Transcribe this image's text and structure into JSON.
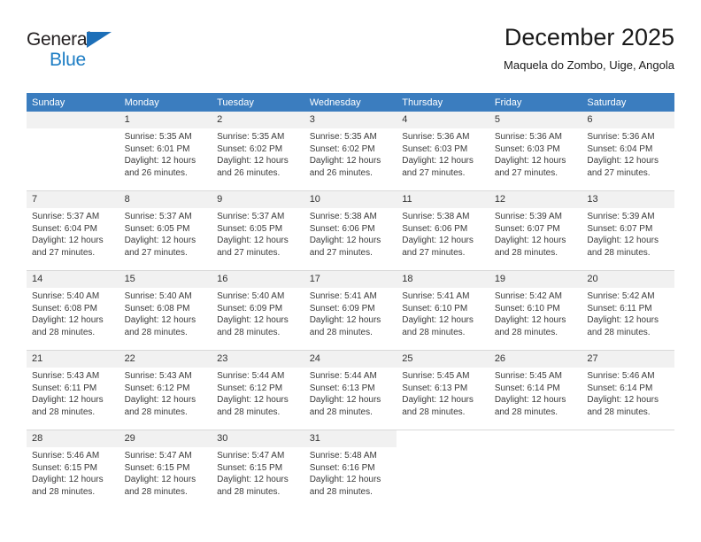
{
  "brand": {
    "name_part1": "General",
    "name_part2": "Blue",
    "triangle_icon": "triangle-icon",
    "colors": {
      "blue": "#1d7dc4",
      "dark": "#231f20",
      "header_blue": "#3b7dbf"
    }
  },
  "header": {
    "title": "December 2025",
    "subtitle": "Maquela do Zombo, Uige, Angola"
  },
  "weekday_headers": [
    "Sunday",
    "Monday",
    "Tuesday",
    "Wednesday",
    "Thursday",
    "Friday",
    "Saturday"
  ],
  "weeks": [
    [
      {
        "day": "",
        "sunrise": "",
        "sunset": "",
        "daylight_line1": "",
        "daylight_line2": "",
        "empty": true
      },
      {
        "day": "1",
        "sunrise": "Sunrise: 5:35 AM",
        "sunset": "Sunset: 6:01 PM",
        "daylight_line1": "Daylight: 12 hours",
        "daylight_line2": "and 26 minutes."
      },
      {
        "day": "2",
        "sunrise": "Sunrise: 5:35 AM",
        "sunset": "Sunset: 6:02 PM",
        "daylight_line1": "Daylight: 12 hours",
        "daylight_line2": "and 26 minutes."
      },
      {
        "day": "3",
        "sunrise": "Sunrise: 5:35 AM",
        "sunset": "Sunset: 6:02 PM",
        "daylight_line1": "Daylight: 12 hours",
        "daylight_line2": "and 26 minutes."
      },
      {
        "day": "4",
        "sunrise": "Sunrise: 5:36 AM",
        "sunset": "Sunset: 6:03 PM",
        "daylight_line1": "Daylight: 12 hours",
        "daylight_line2": "and 27 minutes."
      },
      {
        "day": "5",
        "sunrise": "Sunrise: 5:36 AM",
        "sunset": "Sunset: 6:03 PM",
        "daylight_line1": "Daylight: 12 hours",
        "daylight_line2": "and 27 minutes."
      },
      {
        "day": "6",
        "sunrise": "Sunrise: 5:36 AM",
        "sunset": "Sunset: 6:04 PM",
        "daylight_line1": "Daylight: 12 hours",
        "daylight_line2": "and 27 minutes."
      }
    ],
    [
      {
        "day": "7",
        "sunrise": "Sunrise: 5:37 AM",
        "sunset": "Sunset: 6:04 PM",
        "daylight_line1": "Daylight: 12 hours",
        "daylight_line2": "and 27 minutes."
      },
      {
        "day": "8",
        "sunrise": "Sunrise: 5:37 AM",
        "sunset": "Sunset: 6:05 PM",
        "daylight_line1": "Daylight: 12 hours",
        "daylight_line2": "and 27 minutes."
      },
      {
        "day": "9",
        "sunrise": "Sunrise: 5:37 AM",
        "sunset": "Sunset: 6:05 PM",
        "daylight_line1": "Daylight: 12 hours",
        "daylight_line2": "and 27 minutes."
      },
      {
        "day": "10",
        "sunrise": "Sunrise: 5:38 AM",
        "sunset": "Sunset: 6:06 PM",
        "daylight_line1": "Daylight: 12 hours",
        "daylight_line2": "and 27 minutes."
      },
      {
        "day": "11",
        "sunrise": "Sunrise: 5:38 AM",
        "sunset": "Sunset: 6:06 PM",
        "daylight_line1": "Daylight: 12 hours",
        "daylight_line2": "and 27 minutes."
      },
      {
        "day": "12",
        "sunrise": "Sunrise: 5:39 AM",
        "sunset": "Sunset: 6:07 PM",
        "daylight_line1": "Daylight: 12 hours",
        "daylight_line2": "and 28 minutes."
      },
      {
        "day": "13",
        "sunrise": "Sunrise: 5:39 AM",
        "sunset": "Sunset: 6:07 PM",
        "daylight_line1": "Daylight: 12 hours",
        "daylight_line2": "and 28 minutes."
      }
    ],
    [
      {
        "day": "14",
        "sunrise": "Sunrise: 5:40 AM",
        "sunset": "Sunset: 6:08 PM",
        "daylight_line1": "Daylight: 12 hours",
        "daylight_line2": "and 28 minutes."
      },
      {
        "day": "15",
        "sunrise": "Sunrise: 5:40 AM",
        "sunset": "Sunset: 6:08 PM",
        "daylight_line1": "Daylight: 12 hours",
        "daylight_line2": "and 28 minutes."
      },
      {
        "day": "16",
        "sunrise": "Sunrise: 5:40 AM",
        "sunset": "Sunset: 6:09 PM",
        "daylight_line1": "Daylight: 12 hours",
        "daylight_line2": "and 28 minutes."
      },
      {
        "day": "17",
        "sunrise": "Sunrise: 5:41 AM",
        "sunset": "Sunset: 6:09 PM",
        "daylight_line1": "Daylight: 12 hours",
        "daylight_line2": "and 28 minutes."
      },
      {
        "day": "18",
        "sunrise": "Sunrise: 5:41 AM",
        "sunset": "Sunset: 6:10 PM",
        "daylight_line1": "Daylight: 12 hours",
        "daylight_line2": "and 28 minutes."
      },
      {
        "day": "19",
        "sunrise": "Sunrise: 5:42 AM",
        "sunset": "Sunset: 6:10 PM",
        "daylight_line1": "Daylight: 12 hours",
        "daylight_line2": "and 28 minutes."
      },
      {
        "day": "20",
        "sunrise": "Sunrise: 5:42 AM",
        "sunset": "Sunset: 6:11 PM",
        "daylight_line1": "Daylight: 12 hours",
        "daylight_line2": "and 28 minutes."
      }
    ],
    [
      {
        "day": "21",
        "sunrise": "Sunrise: 5:43 AM",
        "sunset": "Sunset: 6:11 PM",
        "daylight_line1": "Daylight: 12 hours",
        "daylight_line2": "and 28 minutes."
      },
      {
        "day": "22",
        "sunrise": "Sunrise: 5:43 AM",
        "sunset": "Sunset: 6:12 PM",
        "daylight_line1": "Daylight: 12 hours",
        "daylight_line2": "and 28 minutes."
      },
      {
        "day": "23",
        "sunrise": "Sunrise: 5:44 AM",
        "sunset": "Sunset: 6:12 PM",
        "daylight_line1": "Daylight: 12 hours",
        "daylight_line2": "and 28 minutes."
      },
      {
        "day": "24",
        "sunrise": "Sunrise: 5:44 AM",
        "sunset": "Sunset: 6:13 PM",
        "daylight_line1": "Daylight: 12 hours",
        "daylight_line2": "and 28 minutes."
      },
      {
        "day": "25",
        "sunrise": "Sunrise: 5:45 AM",
        "sunset": "Sunset: 6:13 PM",
        "daylight_line1": "Daylight: 12 hours",
        "daylight_line2": "and 28 minutes."
      },
      {
        "day": "26",
        "sunrise": "Sunrise: 5:45 AM",
        "sunset": "Sunset: 6:14 PM",
        "daylight_line1": "Daylight: 12 hours",
        "daylight_line2": "and 28 minutes."
      },
      {
        "day": "27",
        "sunrise": "Sunrise: 5:46 AM",
        "sunset": "Sunset: 6:14 PM",
        "daylight_line1": "Daylight: 12 hours",
        "daylight_line2": "and 28 minutes."
      }
    ],
    [
      {
        "day": "28",
        "sunrise": "Sunrise: 5:46 AM",
        "sunset": "Sunset: 6:15 PM",
        "daylight_line1": "Daylight: 12 hours",
        "daylight_line2": "and 28 minutes."
      },
      {
        "day": "29",
        "sunrise": "Sunrise: 5:47 AM",
        "sunset": "Sunset: 6:15 PM",
        "daylight_line1": "Daylight: 12 hours",
        "daylight_line2": "and 28 minutes."
      },
      {
        "day": "30",
        "sunrise": "Sunrise: 5:47 AM",
        "sunset": "Sunset: 6:15 PM",
        "daylight_line1": "Daylight: 12 hours",
        "daylight_line2": "and 28 minutes."
      },
      {
        "day": "31",
        "sunrise": "Sunrise: 5:48 AM",
        "sunset": "Sunset: 6:16 PM",
        "daylight_line1": "Daylight: 12 hours",
        "daylight_line2": "and 28 minutes."
      },
      {
        "day": "",
        "sunrise": "",
        "sunset": "",
        "daylight_line1": "",
        "daylight_line2": "",
        "blank": true
      },
      {
        "day": "",
        "sunrise": "",
        "sunset": "",
        "daylight_line1": "",
        "daylight_line2": "",
        "blank": true
      },
      {
        "day": "",
        "sunrise": "",
        "sunset": "",
        "daylight_line1": "",
        "daylight_line2": "",
        "blank": true
      }
    ]
  ]
}
